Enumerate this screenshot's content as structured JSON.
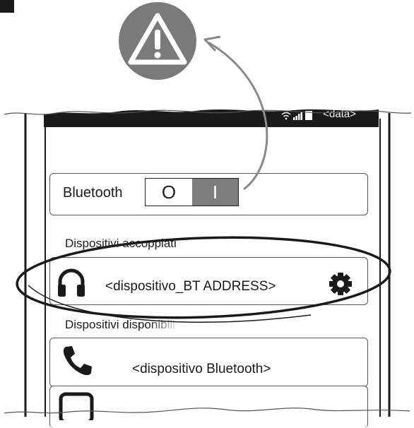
{
  "status_bar": {
    "date": "<data>"
  },
  "bluetooth": {
    "label": "Bluetooth",
    "toggle_off_label": "O",
    "toggle_on_label": "I",
    "state": "on"
  },
  "paired": {
    "heading": "Dispositivi accoppiati",
    "device": {
      "name": "<dispositivo_BT ADDRESS>",
      "icon": "headphones-icon",
      "settings_icon": "gear-icon"
    }
  },
  "available": {
    "heading": "Dispositivi disponibili",
    "devices": [
      {
        "name": "<dispositivo Bluetooth>",
        "icon": "phone-icon"
      },
      {
        "name": "…",
        "icon": "device-icon"
      }
    ]
  },
  "annotation": {
    "icon": "warning-icon"
  },
  "colors": {
    "toggle_on": "#7d7d7d",
    "warning": "#7a7a7a",
    "ink": "#1a1a1a"
  }
}
